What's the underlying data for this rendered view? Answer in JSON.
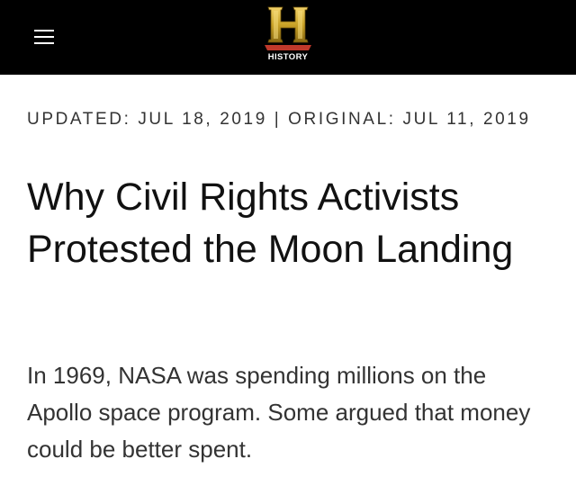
{
  "header": {
    "menu_icon": "hamburger-menu-icon",
    "logo": {
      "letter": "H",
      "text": "HISTORY"
    },
    "colors": {
      "background": "#000000",
      "logo_gold": "#c9a227",
      "logo_red": "#c0392b"
    }
  },
  "article": {
    "dateline": "UPDATED: JUL 18, 2019 | ORIGINAL: JUL 11, 2019",
    "title": "Why Civil Rights Activists Protested the Moon Landing",
    "dek": "In 1969, NASA was spending millions on the Apollo space program. Some argued that money could be better spent."
  }
}
